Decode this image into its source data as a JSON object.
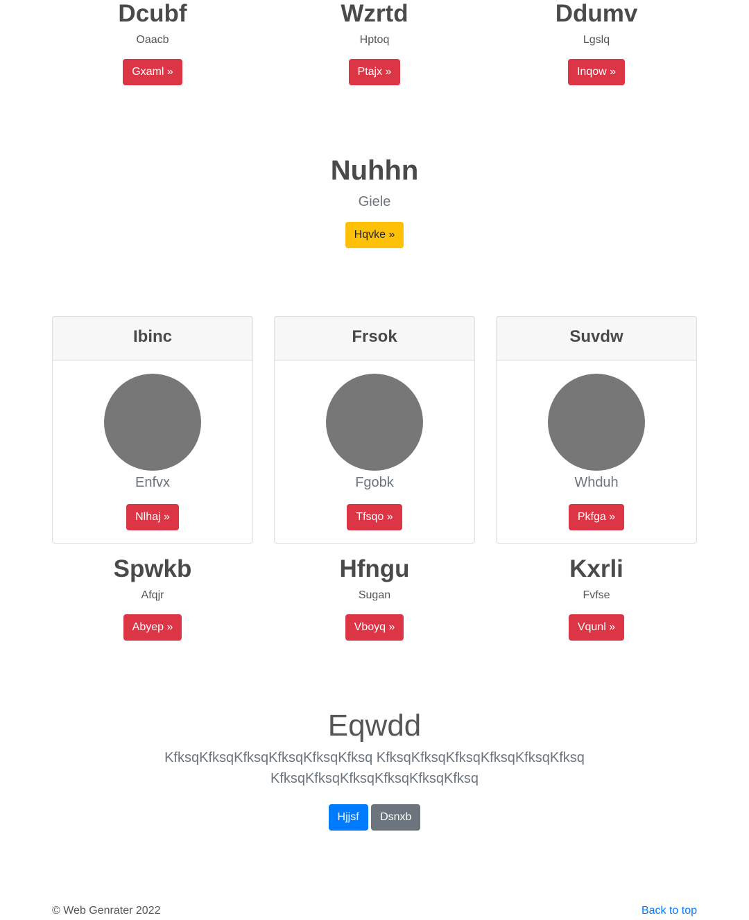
{
  "top_row": [
    {
      "title": "Dcubf",
      "subtitle": "Oaacb",
      "button": "Gxaml »"
    },
    {
      "title": "Wzrtd",
      "subtitle": "Hptoq",
      "button": "Ptajx »"
    },
    {
      "title": "Ddumv",
      "subtitle": "Lgslq",
      "button": "Inqow »"
    }
  ],
  "feature": {
    "title": "Nuhhn",
    "subtitle": "Giele",
    "button": "Hqvke »"
  },
  "cards": [
    {
      "header": "Ibinc",
      "caption": "Enfvx",
      "button": "Nlhaj »"
    },
    {
      "header": "Frsok",
      "caption": "Fgobk",
      "button": "Tfsqo »"
    },
    {
      "header": "Suvdw",
      "caption": "Whduh",
      "button": "Pkfga »"
    }
  ],
  "bottom_row": [
    {
      "title": "Spwkb",
      "subtitle": "Afqjr",
      "button": "Abyep »"
    },
    {
      "title": "Hfngu",
      "subtitle": "Sugan",
      "button": "Vboyq »"
    },
    {
      "title": "Kxrli",
      "subtitle": "Fvfse",
      "button": "Vqunl »"
    }
  ],
  "jumbotron": {
    "title": "Eqwdd",
    "line1": "KfksqKfksqKfksqKfksqKfksqKfksq KfksqKfksqKfksqKfksqKfksqKfksq",
    "line2": "KfksqKfksqKfksqKfksqKfksqKfksq",
    "primary_button": "Hjjsf",
    "secondary_button": "Dsnxb"
  },
  "footer": {
    "copyright": "© Web Genrater 2022",
    "back_to_top": "Back to top"
  },
  "colors": {
    "danger": "#dc3545",
    "warning": "#ffc107",
    "primary": "#007bff",
    "secondary": "#6c757d",
    "avatar": "#777777"
  }
}
